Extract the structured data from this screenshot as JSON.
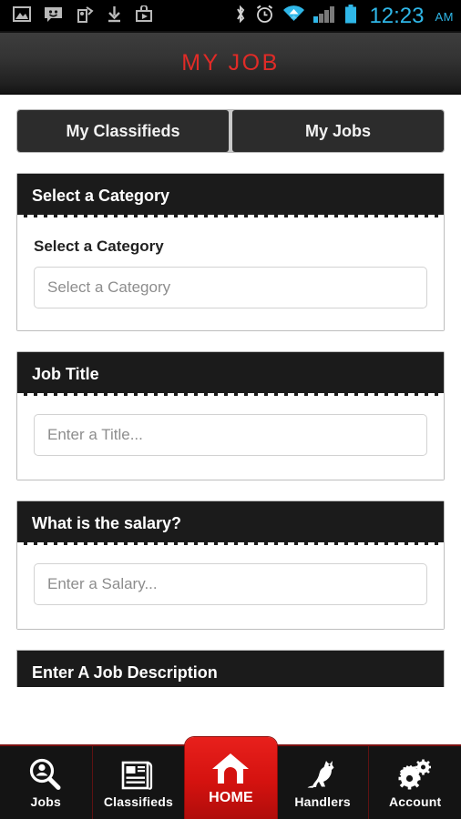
{
  "status_bar": {
    "left_icons": [
      {
        "name": "photo-icon"
      },
      {
        "name": "message-smiley-icon"
      },
      {
        "name": "lock-tag-icon"
      },
      {
        "name": "download-icon"
      },
      {
        "name": "store-bag-icon"
      }
    ],
    "right_icons": [
      {
        "name": "bluetooth-icon"
      },
      {
        "name": "alarm-clock-icon"
      },
      {
        "name": "wifi-icon"
      },
      {
        "name": "cellular-signal-icon"
      },
      {
        "name": "battery-icon"
      }
    ],
    "time": "12:23",
    "meridiem": "AM",
    "accent_color": "#2fb7e8"
  },
  "header": {
    "title": "MY JOB",
    "title_color": "#e02b27"
  },
  "tabs": [
    {
      "label": "My Classifieds",
      "selected": false
    },
    {
      "label": "My Jobs",
      "selected": true
    }
  ],
  "sections": [
    {
      "heading": "Select a Category",
      "field_label": "Select a Category",
      "input_placeholder": "Select a Category",
      "input_value": ""
    },
    {
      "heading": "Job Title",
      "field_label": "",
      "input_placeholder": "Enter a Title...",
      "input_value": ""
    },
    {
      "heading": "What is the salary?",
      "field_label": "",
      "input_placeholder": "Enter a Salary...",
      "input_value": ""
    }
  ],
  "partial_section": {
    "heading": "Enter A Job Description"
  },
  "bottom_nav": {
    "active_color": "#d4120f",
    "items": [
      {
        "label": "Jobs",
        "icon": "person-search-icon",
        "active": false
      },
      {
        "label": "Classifieds",
        "icon": "newspaper-icon",
        "active": false
      },
      {
        "label": "HOME",
        "icon": "doghouse-icon",
        "active": true
      },
      {
        "label": "Handlers",
        "icon": "dog-icon",
        "active": false
      },
      {
        "label": "Account",
        "icon": "gears-icon",
        "active": false
      }
    ]
  }
}
